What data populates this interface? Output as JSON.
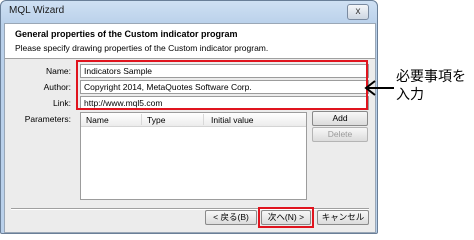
{
  "window": {
    "title": "MQL Wizard",
    "close_glyph": "x"
  },
  "header": {
    "title": "General properties of the Custom indicator program",
    "subtitle": "Please specify drawing properties of the Custom indicator program."
  },
  "form": {
    "name_label": "Name:",
    "name_value": "Indicators Sample",
    "author_label": "Author:",
    "author_value": "Copyright 2014, MetaQuotes Software Corp.",
    "link_label": "Link:",
    "link_value": "http://www.mql5.com",
    "parameters_label": "Parameters:"
  },
  "parameters_table": {
    "columns": [
      "Name",
      "Type",
      "Initial value"
    ],
    "rows": []
  },
  "side_buttons": {
    "add_label": "Add",
    "delete_label": "Delete"
  },
  "footer": {
    "back_label": "< 戻る(B)",
    "next_label": "次へ(N) >",
    "cancel_label": "キャンセル"
  },
  "annotation": {
    "line1": "必要事項を",
    "line2": "入力"
  },
  "colors": {
    "highlight": "#e0141e"
  }
}
